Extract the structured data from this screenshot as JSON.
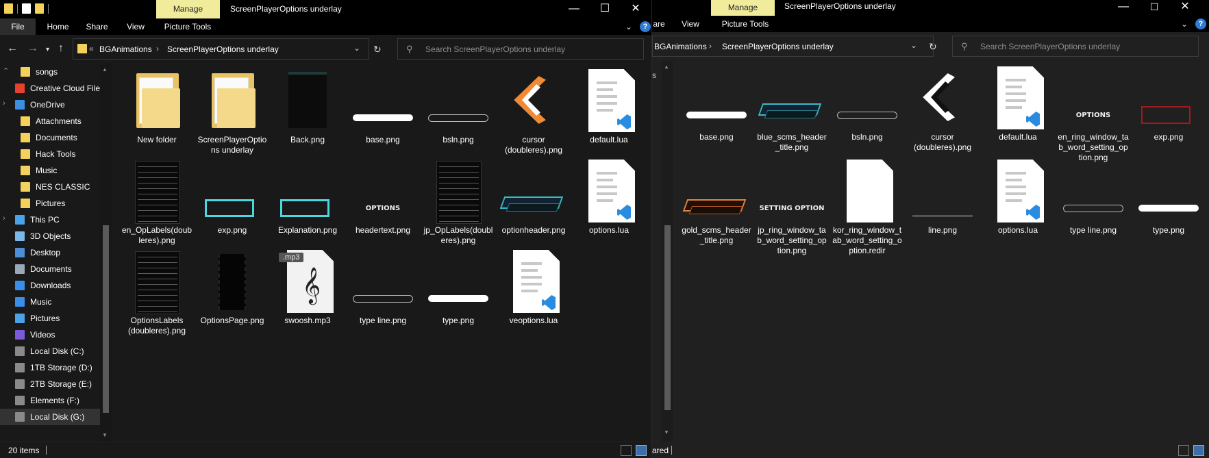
{
  "window_left": {
    "title": "ScreenPlayerOptions underlay",
    "context_tab": "Manage",
    "ribbon_tabs": [
      "File",
      "Home",
      "Share",
      "View",
      "Picture Tools"
    ],
    "breadcrumb": [
      "BGAnimations",
      "ScreenPlayerOptions underlay"
    ],
    "breadcrumb_prefix": "«",
    "search_placeholder": "Search ScreenPlayerOptions underlay",
    "nav_items": [
      {
        "label": "songs",
        "icon": "folder-icon"
      },
      {
        "label": "Creative Cloud File",
        "icon": "creative-cloud-icon"
      },
      {
        "label": "OneDrive",
        "icon": "cloud-icon"
      },
      {
        "label": "Attachments",
        "icon": "folder-icon"
      },
      {
        "label": "Documents",
        "icon": "folder-icon"
      },
      {
        "label": "Hack Tools",
        "icon": "folder-icon"
      },
      {
        "label": "Music",
        "icon": "folder-icon"
      },
      {
        "label": "NES CLASSIC",
        "icon": "folder-icon"
      },
      {
        "label": "Pictures",
        "icon": "folder-icon"
      },
      {
        "label": "This PC",
        "icon": "computer-icon"
      },
      {
        "label": "3D Objects",
        "icon": "cube-icon"
      },
      {
        "label": "Desktop",
        "icon": "desktop-icon"
      },
      {
        "label": "Documents",
        "icon": "documents-icon"
      },
      {
        "label": "Downloads",
        "icon": "download-icon"
      },
      {
        "label": "Music",
        "icon": "music-icon"
      },
      {
        "label": "Pictures",
        "icon": "pictures-icon"
      },
      {
        "label": "Videos",
        "icon": "videos-icon"
      },
      {
        "label": "Local Disk (C:)",
        "icon": "drive-icon"
      },
      {
        "label": "1TB Storage (D:)",
        "icon": "drive-icon"
      },
      {
        "label": "2TB Storage (E:)",
        "icon": "drive-icon"
      },
      {
        "label": "Elements (F:)",
        "icon": "drive-icon"
      },
      {
        "label": "Local Disk (G:)",
        "icon": "drive-icon"
      }
    ],
    "files": [
      {
        "name": "New folder",
        "kind": "folder"
      },
      {
        "name": "ScreenPlayerOptions underlay",
        "kind": "folder"
      },
      {
        "name": "Back.png",
        "kind": "dark-image"
      },
      {
        "name": "base.png",
        "kind": "white-bar"
      },
      {
        "name": "bsln.png",
        "kind": "outline-bar"
      },
      {
        "name": "cursor (doubleres).png",
        "kind": "cursor"
      },
      {
        "name": "default.lua",
        "kind": "lua"
      },
      {
        "name": "en_OpLabels(doubleres).png",
        "kind": "list"
      },
      {
        "name": "exp.png",
        "kind": "cyan-rect"
      },
      {
        "name": "Explanation.png",
        "kind": "cyan-rect"
      },
      {
        "name": "headertext.png",
        "kind": "text-image",
        "image_text": "OPTIONS"
      },
      {
        "name": "jp_OpLabels(doubleres).png",
        "kind": "list"
      },
      {
        "name": "optionheader.png",
        "kind": "header"
      },
      {
        "name": "options.lua",
        "kind": "lua"
      },
      {
        "name": "OptionsLabels (doubleres).png",
        "kind": "list"
      },
      {
        "name": "OptionsPage.png",
        "kind": "dark-strip"
      },
      {
        "name": "swoosh.mp3",
        "kind": "mp3",
        "badge": ".mp3"
      },
      {
        "name": "type line.png",
        "kind": "outline-bar"
      },
      {
        "name": "type.png",
        "kind": "white-bar"
      },
      {
        "name": "veoptions.lua",
        "kind": "lua"
      }
    ],
    "status": "20 items"
  },
  "window_right": {
    "title": "ScreenPlayerOptions underlay",
    "context_tab": "Manage",
    "ribbon_tabs": [
      "are",
      "View",
      "Picture Tools"
    ],
    "breadcrumb": [
      "BGAnimations",
      "ScreenPlayerOptions underlay"
    ],
    "search_placeholder": "Search ScreenPlayerOptions underlay",
    "nav_partial": "s",
    "files": [
      {
        "name": "base.png",
        "kind": "white-bar"
      },
      {
        "name": "blue_scms_header_title.png",
        "kind": "header"
      },
      {
        "name": "bsln.png",
        "kind": "outline-bar"
      },
      {
        "name": "cursor (doubleres).png",
        "kind": "cursor-bw"
      },
      {
        "name": "default.lua",
        "kind": "lua"
      },
      {
        "name": "en_ring_window_tab_word_setting_option.png",
        "kind": "text-image",
        "image_text": "OPTIONS"
      },
      {
        "name": "exp.png",
        "kind": "red-rect"
      },
      {
        "name": "gold_scms_header_title.png",
        "kind": "header-gold"
      },
      {
        "name": "jp_ring_window_tab_word_setting_option.png",
        "kind": "text-image",
        "image_text": "SETTING OPTION"
      },
      {
        "name": "kor_ring_window_tab_word_setting_option.redir",
        "kind": "blank"
      },
      {
        "name": "line.png",
        "kind": "line"
      },
      {
        "name": "options.lua",
        "kind": "lua"
      },
      {
        "name": "type line.png",
        "kind": "outline-bar"
      },
      {
        "name": "type.png",
        "kind": "white-bar"
      }
    ],
    "status": "ared"
  },
  "colors": {
    "manage_tab": "#f1ec9c",
    "folder": "#f3d15b",
    "vscode": "#2a8ce0",
    "cyan": "#4ad7e0"
  }
}
